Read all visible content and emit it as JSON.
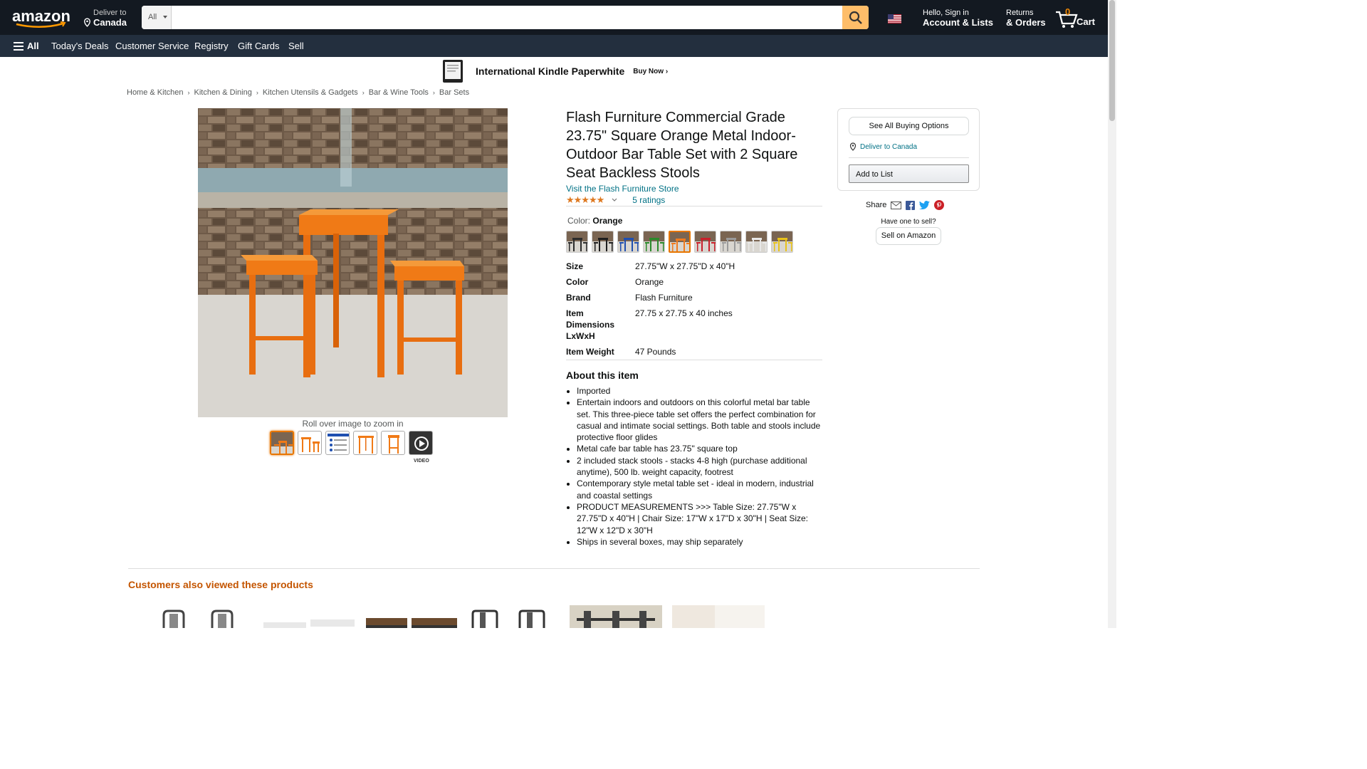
{
  "header": {
    "logo_text": "amazon",
    "deliver_line1": "Deliver to",
    "deliver_line2": "Canada",
    "search_dept": "All",
    "search_placeholder": "",
    "account_line1": "Hello, Sign in",
    "account_line2": "Account & Lists",
    "returns_line1": "Returns",
    "returns_line2": "& Orders",
    "cart_count": "0",
    "cart_label": "Cart"
  },
  "nav": {
    "all": "All",
    "links": [
      "Today's Deals",
      "Customer Service",
      "Registry",
      "Gift Cards",
      "Sell"
    ]
  },
  "banner": {
    "title": "International Kindle Paperwhite",
    "cta": "Buy Now ›"
  },
  "breadcrumbs": [
    "Home & Kitchen",
    "Kitchen & Dining",
    "Kitchen Utensils & Gadgets",
    "Bar & Wine Tools",
    "Bar Sets"
  ],
  "gallery": {
    "zoom_hint": "Roll over image to zoom in",
    "video_label": "VIDEO"
  },
  "product": {
    "title": "Flash Furniture Commercial Grade 23.75\" Square Orange Metal Indoor-Outdoor Bar Table Set with 2 Square Seat Backless Stools",
    "store_link": "Visit the Flash Furniture Store",
    "stars": "★★★★★",
    "rating_count": "5 ratings",
    "color_label": "Color:",
    "color_value": "Orange",
    "swatch_colors": [
      "#2b2b2b",
      "#1e1e1e",
      "#1f4fb0",
      "#2b8a2b",
      "#f07b1e",
      "#c8202a",
      "#9a9a9a",
      "#e8e8e8",
      "#e8c21a"
    ],
    "specs": [
      {
        "k": "Size",
        "v": "27.75\"W x 27.75\"D x 40\"H"
      },
      {
        "k": "Color",
        "v": "Orange"
      },
      {
        "k": "Brand",
        "v": "Flash Furniture"
      },
      {
        "k": "Item Dimensions LxWxH",
        "v": "27.75 x 27.75 x 40 inches"
      },
      {
        "k": "Item Weight",
        "v": "47 Pounds"
      }
    ],
    "about_title": "About this item",
    "bullets": [
      "Imported",
      "Entertain indoors and outdoors on this colorful metal bar table set. This three-piece table set offers the perfect combination for casual and intimate social settings. Both table and stools include protective floor glides",
      "Metal cafe bar table has 23.75\" square top",
      "2 included stack stools - stacks 4-8 high (purchase additional anytime), 500 lb. weight capacity, footrest",
      "Contemporary style metal table set - ideal in modern, industrial and coastal settings",
      "PRODUCT MEASUREMENTS >>> Table Size: 27.75\"W x 27.75\"D x 40\"H | Chair Size: 17\"W x 17\"D x 30\"H | Seat Size: 12\"W x 12\"D x 30\"H",
      "Ships in several boxes, may ship separately"
    ]
  },
  "buybox": {
    "see_all": "See All Buying Options",
    "deliver": "Deliver to Canada",
    "add_to_list": "Add to List",
    "share": "Share",
    "have_one": "Have one to sell?",
    "sell_on": "Sell on Amazon"
  },
  "also_viewed": {
    "title": "Customers also viewed these products"
  },
  "colors": {
    "header_bg": "#131921",
    "nav_bg": "#232f3e",
    "search_btn": "#febd69",
    "link": "#007185",
    "star": "#de7921",
    "section_title": "#c45500"
  }
}
